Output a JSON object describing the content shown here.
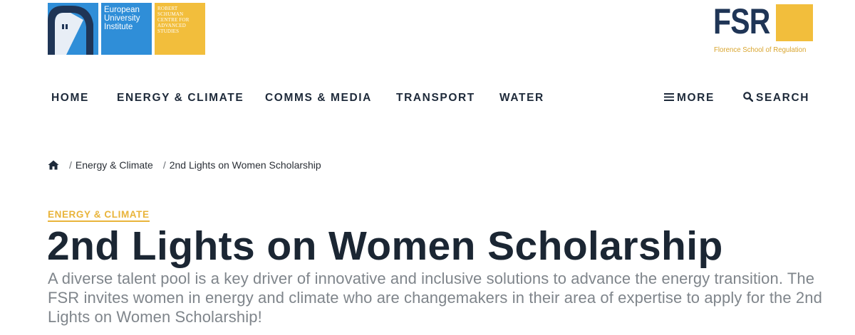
{
  "header": {
    "eui_logo": {
      "name_lines": [
        "European",
        "University",
        "Institute"
      ],
      "centre_lines": [
        "ROBERT",
        "SCHUMAN",
        "CENTRE FOR",
        "ADVANCED",
        "STUDIES"
      ],
      "colors": {
        "blue": "#2f8ed8",
        "navy": "#1f3556",
        "yellow": "#f2be3c"
      }
    },
    "fsr_logo": {
      "letters": "FSR",
      "subtitle": "Florence School of Regulation",
      "colors": {
        "navy": "#1f3556",
        "yellow": "#f2be3c"
      }
    }
  },
  "nav": {
    "items": [
      {
        "label": "HOME"
      },
      {
        "label": "ENERGY & CLIMATE"
      },
      {
        "label": "COMMS & MEDIA"
      },
      {
        "label": "TRANSPORT"
      },
      {
        "label": "WATER"
      }
    ],
    "more": {
      "label": "MORE",
      "icon": "hamburger-icon"
    },
    "search": {
      "label": "SEARCH",
      "icon": "search-icon"
    }
  },
  "breadcrumb": {
    "home_icon": "home-icon",
    "separator": "/",
    "items": [
      {
        "label": "Energy & Climate"
      },
      {
        "label": "2nd Lights on Women Scholarship"
      }
    ]
  },
  "article": {
    "category": "ENERGY & CLIMATE",
    "title": "2nd Lights on Women Scholarship",
    "lead": "A diverse talent pool is a key driver of innovative and inclusive solutions to advance the energy transition. The FSR invites women in energy and climate who are changemakers in their area of expertise to apply for the 2nd Lights on Women Scholarship!"
  },
  "colors": {
    "text_dark": "#1b2633",
    "text_muted": "#7f858b",
    "accent_yellow": "#e9b43a"
  }
}
